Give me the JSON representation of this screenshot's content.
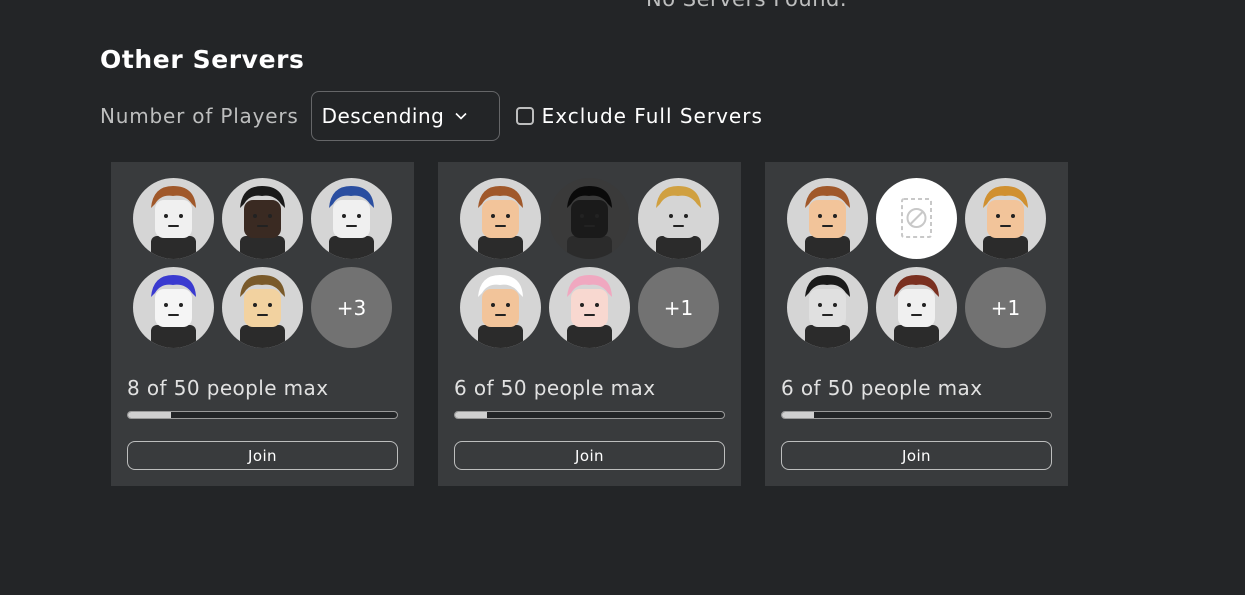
{
  "top_message": "No Servers Found.",
  "section_title": "Other Servers",
  "filters": {
    "sort_label": "Number of Players",
    "sort_value": "Descending",
    "exclude_label": "Exclude Full Servers",
    "exclude_checked": false
  },
  "servers": [
    {
      "count_text": "8 of 50 people max",
      "fill_fraction": 0.16,
      "join_label": "Join",
      "more_label": "+3",
      "avatars": [
        {
          "icon": "player-avatar-icon",
          "skin": "#f0f0f0",
          "hair": "#a0582a",
          "bg": "#d5d5d5"
        },
        {
          "icon": "player-avatar-icon",
          "skin": "#3a2a22",
          "hair": "#1a1a1a",
          "bg": "#d5d5d5"
        },
        {
          "icon": "player-avatar-icon",
          "skin": "#f0f0f0",
          "hair": "#2a4ea0",
          "bg": "#d5d5d5"
        },
        {
          "icon": "player-avatar-icon",
          "skin": "#f5f5f5",
          "hair": "#3a3ad0",
          "bg": "#d5d5d5"
        },
        {
          "icon": "player-avatar-icon",
          "skin": "#f2d2a0",
          "hair": "#7a5a2a",
          "bg": "#d5d5d5"
        }
      ]
    },
    {
      "count_text": "6 of 50 people max",
      "fill_fraction": 0.12,
      "join_label": "Join",
      "more_label": "+1",
      "avatars": [
        {
          "icon": "player-avatar-icon",
          "skin": "#f2c49a",
          "hair": "#a0582a",
          "bg": "#d5d5d5"
        },
        {
          "icon": "player-avatar-icon",
          "skin": "#1a1a1a",
          "hair": "#0a0a0a",
          "bg": "#3a3a3a"
        },
        {
          "icon": "player-avatar-icon",
          "skin": "#d5d5d5",
          "hair": "#d0a040",
          "bg": "#d5d5d5"
        },
        {
          "icon": "player-avatar-icon",
          "skin": "#f2c49a",
          "hair": "#ffffff",
          "bg": "#d5d5d5"
        },
        {
          "icon": "player-avatar-icon",
          "skin": "#f8d8d0",
          "hair": "#f0a8c0",
          "bg": "#d5d5d5"
        }
      ]
    },
    {
      "count_text": "6 of 50 people max",
      "fill_fraction": 0.12,
      "join_label": "Join",
      "more_label": "+1",
      "avatars": [
        {
          "icon": "player-avatar-icon",
          "skin": "#f2c49a",
          "hair": "#a0582a",
          "bg": "#d5d5d5"
        },
        {
          "icon": "blocked-avatar-icon",
          "skin": "",
          "hair": "",
          "bg": "#ffffff"
        },
        {
          "icon": "player-avatar-icon",
          "skin": "#f2c49a",
          "hair": "#d09030",
          "bg": "#d5d5d5"
        },
        {
          "icon": "player-avatar-icon",
          "skin": "#e0e0e0",
          "hair": "#1a1a1a",
          "bg": "#d5d5d5"
        },
        {
          "icon": "player-avatar-icon",
          "skin": "#f0f0f0",
          "hair": "#7a3020",
          "bg": "#d5d5d5"
        }
      ]
    }
  ]
}
